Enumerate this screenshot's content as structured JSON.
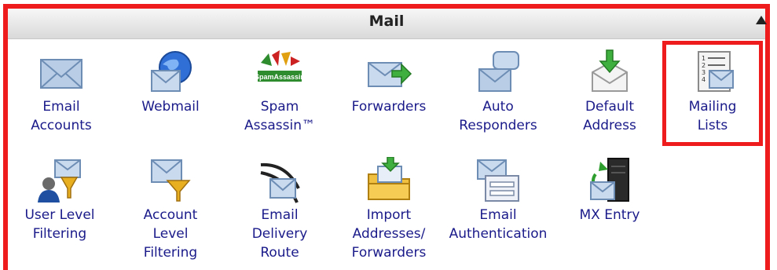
{
  "section": {
    "title": "Mail"
  },
  "items": [
    {
      "label": "Email\nAccounts",
      "icon": "envelope-icon"
    },
    {
      "label": "Webmail",
      "icon": "globe-envelope-icon"
    },
    {
      "label": "Spam\nAssassin™",
      "icon": "spamassassin-logo-icon",
      "logo_text": "SpamAssassin"
    },
    {
      "label": "Forwarders",
      "icon": "envelope-forward-icon"
    },
    {
      "label": "Auto\nResponders",
      "icon": "envelope-speech-bubble-icon"
    },
    {
      "label": "Default\nAddress",
      "icon": "envelope-download-arrow-icon"
    },
    {
      "label": "Mailing\nLists",
      "icon": "numbered-list-envelope-icon",
      "list_numbers": [
        "1",
        "2",
        "3",
        "4"
      ]
    },
    {
      "label": "User Level\nFiltering",
      "icon": "user-filter-icon"
    },
    {
      "label": "Account\nLevel\nFiltering",
      "icon": "envelope-funnel-icon"
    },
    {
      "label": "Email\nDelivery\nRoute",
      "icon": "envelope-route-icon"
    },
    {
      "label": "Import\nAddresses/\nForwarders",
      "icon": "folder-import-icon"
    },
    {
      "label": "Email\nAuthentication",
      "icon": "envelope-form-icon"
    },
    {
      "label": "MX Entry",
      "icon": "server-envelope-icon"
    }
  ],
  "colors": {
    "highlight": "#ee1c1c",
    "label": "#1a1a8a",
    "envelope": "#9fb9d9"
  }
}
